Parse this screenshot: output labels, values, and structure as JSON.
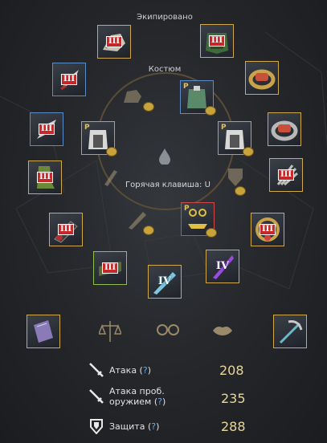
{
  "headings": {
    "equipped": "Экипировано",
    "costume": "Костюм",
    "hotkey": "Горячая клавиша: U"
  },
  "slots": {
    "main_weapon": {
      "tier": "III",
      "icon": "gauntlet-weapon-icon"
    },
    "armor": {
      "tier": "III",
      "icon": "leaf-armor-icon"
    },
    "ring_1": {
      "icon": "ring-icon"
    },
    "ring_2": {
      "icon": "ring-icon"
    },
    "gloves": {
      "tier": "III",
      "icon": "claw-gloves-icon"
    },
    "shoes": {
      "tier": "III",
      "icon": "claw-shoes-icon"
    },
    "left_earring": {
      "tier": "III",
      "icon": "earring-icon"
    },
    "right_earring": {
      "tier": "III",
      "icon": "claw-icon"
    },
    "necklace": {
      "tier": "III",
      "icon": "necklace-icon"
    },
    "belt": {
      "tier": "III",
      "icon": "belt-icon"
    },
    "sub_weapon": {
      "tier": "III",
      "icon": "sub-weapon-icon"
    },
    "awakening": {
      "tier": "IV",
      "icon": "sword-icon"
    },
    "artifact": {
      "tier": "IV",
      "icon": "purple-blade-icon"
    },
    "alchemy_stone": {
      "icon": "stone-book-icon"
    },
    "pickaxe": {
      "icon": "pickaxe-icon"
    },
    "costume_main": {
      "mark": "P",
      "icon": "costume-armor-icon"
    },
    "costume_left": {
      "mark": "P",
      "icon": "costume-armor-icon"
    },
    "costume_right": {
      "mark": "P",
      "icon": "costume-armor-icon"
    },
    "costume_underwear": {
      "mark": "P",
      "icon": "underwear-icon"
    }
  },
  "tools": [
    "scale-icon",
    "goggles-icon",
    "lips-icon"
  ],
  "stats": [
    {
      "label": "Атака (",
      "q": "?",
      "close": ")",
      "value": "208"
    },
    {
      "label_line1": "Атака проб.",
      "label_line2": "оружием (",
      "q": "?",
      "close": ")",
      "value": "235"
    },
    {
      "label": "Защита (",
      "q": "?",
      "close": ")",
      "value": "288"
    }
  ],
  "colors": {
    "gold_frame": "#d1a94b",
    "blue_frame": "#5a8cc8",
    "tier_red": "#c42828",
    "value": "#e8d79a",
    "question": "#6aa8e8"
  }
}
